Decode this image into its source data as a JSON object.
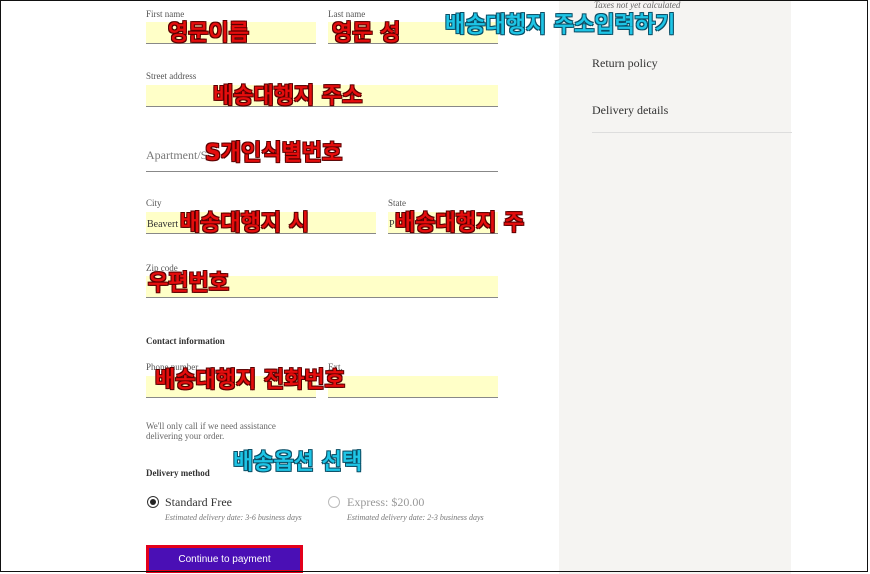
{
  "summary": {
    "tax_note": "Taxes not yet calculated",
    "return_policy": "Return policy",
    "delivery_details": "Delivery details"
  },
  "form": {
    "first_name_label": "First name",
    "last_name_label": "Last name",
    "street_label": "Street address",
    "apartment_placeholder": "Apartment/S",
    "city_label": "City",
    "city_value": "Beavert",
    "state_label": "State",
    "state_value": "P",
    "zip_label": "Zip code",
    "contact_title": "Contact information",
    "phone_label": "Phone number",
    "ext_label": "Ext.",
    "contact_note": "We'll only call if we need assistance delivering your order.",
    "delivery_title": "Delivery method",
    "options": [
      {
        "label": "Standard Free",
        "sub": "Estimated delivery date: 3-6 business days",
        "selected": true
      },
      {
        "label": "Express: $20.00",
        "sub": "Estimated delivery date: 2-3 business days",
        "selected": false
      }
    ],
    "continue_label": "Continue to payment"
  },
  "annotations": {
    "first_name": "영문이름",
    "last_name": "영문 성",
    "heading": "배송대행지 주소입력하기",
    "street": "배송대행지 주소",
    "apartment": "S개인식별번호",
    "city": "배송대행지 시",
    "state": "배송대행지 주",
    "zip": "우편번호",
    "phone": "배송대행지 전화번호",
    "delivery": "배송옵션 선택"
  },
  "colors": {
    "highlight": "#ffffc8",
    "button": "#4a0fb5",
    "button_border": "#e3001b",
    "annotation_red": "#e50d0d",
    "annotation_cyan": "#1ec5e6"
  }
}
